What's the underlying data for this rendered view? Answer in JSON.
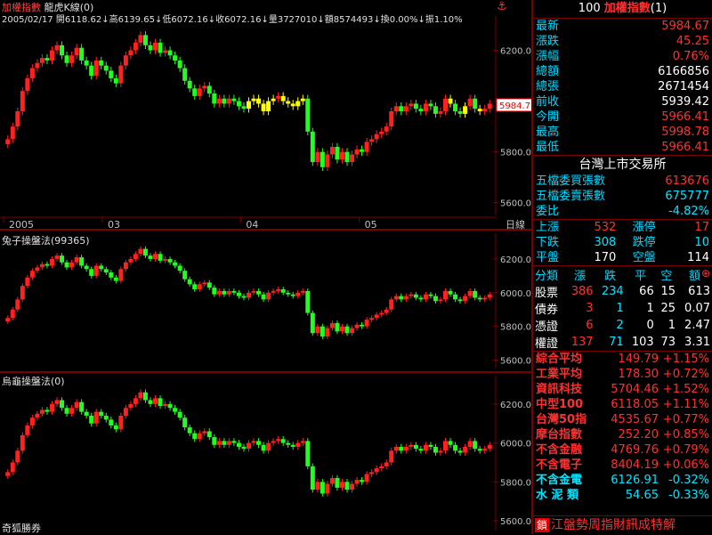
{
  "chart1": {
    "title": "加權指數",
    "indicator": "龍虎K線(0)",
    "stats": {
      "date": "2005/02/17",
      "open": "開6118.62",
      "high": "高6139.65",
      "low": "低6072.16",
      "close": "收6072.16",
      "volume": "量3727010",
      "amount": "額8574493",
      "turnover": "換0.00%",
      "amplitude": "振1.10%"
    },
    "yticks": [
      "6200.0",
      "6000.0",
      "5800.0",
      "5600.0"
    ],
    "last_price_tag": "5984.7",
    "xticks": [
      "2005",
      "03",
      "04",
      "05"
    ],
    "period_label": "日線",
    "anchor_icon": "anchor-icon"
  },
  "chart2": {
    "title": "兔子操盤法(99365)",
    "yticks": [
      "6200.0",
      "6000.0",
      "5800.0",
      "5600.0"
    ]
  },
  "chart3": {
    "title": "烏龜操盤法(0)",
    "yticks": [
      "6200.0",
      "6000.0",
      "5800.0",
      "5600.0"
    ],
    "footer": "奇狐勝券"
  },
  "chart_data": {
    "type": "candlestick",
    "ylim": [
      5550,
      6300
    ],
    "xticks": [
      "2005",
      "03",
      "04",
      "05"
    ],
    "close": [
      5850,
      5900,
      5960,
      6040,
      6090,
      6130,
      6150,
      6170,
      6160,
      6200,
      6220,
      6180,
      6150,
      6180,
      6210,
      6160,
      6140,
      6100,
      6160,
      6140,
      6120,
      6090,
      6070,
      6140,
      6180,
      6200,
      6230,
      6260,
      6220,
      6200,
      6230,
      6190,
      6200,
      6180,
      6160,
      6130,
      6080,
      6050,
      6020,
      6050,
      6060,
      6030,
      5990,
      6010,
      5990,
      6010,
      6000,
      5980,
      5970,
      6000,
      6010,
      5990,
      5960,
      6000,
      6010,
      6020,
      6000,
      5990,
      5980,
      6000,
      6010,
      5880,
      5760,
      5800,
      5740,
      5790,
      5820,
      5770,
      5800,
      5760,
      5790,
      5810,
      5800,
      5840,
      5850,
      5870,
      5880,
      5900,
      5960,
      5980,
      5960,
      5980,
      5990,
      5970,
      5960,
      5990,
      5980,
      5950,
      5960,
      6010,
      5990,
      5960,
      5950,
      5980,
      6010,
      5970,
      5960,
      5970,
      5990
    ],
    "last_value": 5984.7,
    "volume_text": "3727010"
  },
  "quote": {
    "code": "100",
    "name": "加權指數",
    "suffix": "(1)",
    "rows": [
      {
        "label": "最新",
        "value": "5984.67",
        "color": "#ff3030"
      },
      {
        "label": "漲跌",
        "value": "45.25",
        "color": "#ff3030"
      },
      {
        "label": "漲幅",
        "value": "0.76%",
        "color": "#ff3030"
      },
      {
        "label": "總額",
        "value": "6166856",
        "color": "#ffffff"
      },
      {
        "label": "總張",
        "value": "2671454",
        "color": "#ffffff"
      },
      {
        "label": "前收",
        "value": "5939.42",
        "color": "#ffffff"
      },
      {
        "label": "今開",
        "value": "5966.41",
        "color": "#ff3030"
      },
      {
        "label": "最高",
        "value": "5998.78",
        "color": "#ff3030"
      },
      {
        "label": "最低",
        "value": "5966.41",
        "color": "#ff3030"
      }
    ]
  },
  "exchange": {
    "title": "台灣上市交易所",
    "rows": [
      {
        "label": "五檔委買張數",
        "value": "613676",
        "color": "#ff3030"
      },
      {
        "label": "五檔委賣張數",
        "value": "675777",
        "color": "#00e5ff"
      },
      {
        "label": "委比",
        "value": "-4.82%",
        "color": "#00e5ff"
      }
    ]
  },
  "breadth": [
    {
      "l1": "上漲",
      "v1": "532",
      "c1": "#ff3030",
      "l2": "漲停",
      "v2": "17",
      "c2": "#ff3030"
    },
    {
      "l1": "下跌",
      "v1": "308",
      "c1": "#00e5ff",
      "l2": "跌停",
      "v2": "10",
      "c2": "#00e5ff"
    },
    {
      "l1": "平盤",
      "v1": "170",
      "c1": "#ffffff",
      "l2": "空盤",
      "v2": "114",
      "c2": "#ffffff"
    }
  ],
  "category_table": {
    "headers": [
      "分類",
      "漲",
      "跌",
      "平",
      "空",
      "額"
    ],
    "rows": [
      [
        "股票",
        "386",
        "234",
        "66",
        "15",
        "613"
      ],
      [
        "債券",
        "3",
        "1",
        "1",
        "25",
        "0.07"
      ],
      [
        "憑證",
        "6",
        "2",
        "0",
        "1",
        "2.47"
      ],
      [
        "權證",
        "137",
        "71",
        "103",
        "73",
        "3.31"
      ]
    ],
    "gear_icon": "gear-icon"
  },
  "indices": [
    {
      "name": "綜合平均",
      "value": "149.79",
      "pct": "+1.15%",
      "color": "#ff3030"
    },
    {
      "name": "工業平均",
      "value": "178.30",
      "pct": "+0.72%",
      "color": "#ff3030"
    },
    {
      "name": "資訊科技",
      "value": "5704.46",
      "pct": "+1.52%",
      "color": "#ff3030"
    },
    {
      "name": "中型100",
      "value": "6118.05",
      "pct": "+1.11%",
      "color": "#ff3030"
    },
    {
      "name": "台灣50指",
      "value": "4535.67",
      "pct": "+0.77%",
      "color": "#ff3030"
    },
    {
      "name": "摩台指數",
      "value": "252.20",
      "pct": "+0.85%",
      "color": "#ff3030"
    },
    {
      "name": "不含金融",
      "value": "4769.76",
      "pct": "+0.79%",
      "color": "#ff3030"
    },
    {
      "name": "不含電子",
      "value": "8404.19",
      "pct": "+0.06%",
      "color": "#ff3030"
    },
    {
      "name": "不含金電",
      "value": "6126.91",
      "pct": "-0.32%",
      "color": "#00e5ff"
    },
    {
      "name": "水 泥 類",
      "value": "54.65",
      "pct": "-0.33%",
      "color": "#00e5ff"
    }
  ],
  "ticker": {
    "icon_label": "鎖",
    "text": "江盤勢周指財訊成特解"
  }
}
